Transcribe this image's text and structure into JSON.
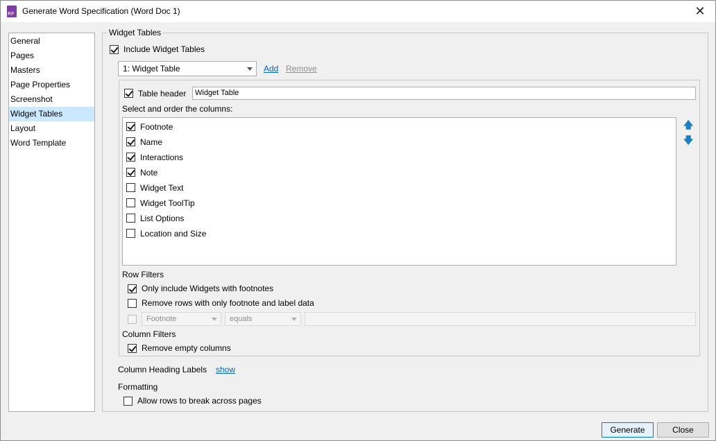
{
  "window": {
    "title": "Generate Word Specification (Word Doc 1)",
    "app_icon_text": "RP",
    "close_symbol": "✕"
  },
  "sidebar": {
    "items": [
      {
        "label": "General"
      },
      {
        "label": "Pages"
      },
      {
        "label": "Masters"
      },
      {
        "label": "Page Properties"
      },
      {
        "label": "Screenshot"
      },
      {
        "label": "Widget Tables",
        "selected": true
      },
      {
        "label": "Layout"
      },
      {
        "label": "Word Template"
      }
    ]
  },
  "widget_tables": {
    "group_title": "Widget Tables",
    "include_label": "Include Widget Tables",
    "include_checked": true,
    "table_select_value": "1: Widget Table",
    "add_label": "Add",
    "remove_label": "Remove",
    "table_header_label": "Table header",
    "table_header_checked": true,
    "table_header_value": "Widget Table",
    "columns_label": "Select and order the columns:",
    "columns": [
      {
        "label": "Footnote",
        "checked": true
      },
      {
        "label": "Name",
        "checked": true
      },
      {
        "label": "Interactions",
        "checked": true
      },
      {
        "label": "Note",
        "checked": true
      },
      {
        "label": "Widget Text",
        "checked": false
      },
      {
        "label": "Widget ToolTip",
        "checked": false
      },
      {
        "label": "List Options",
        "checked": false
      },
      {
        "label": "Location and Size",
        "checked": false
      }
    ],
    "move_up_symbol": "🡅",
    "move_down_symbol": "🡇",
    "row_filters_label": "Row Filters",
    "only_footnotes_label": "Only include Widgets with footnotes",
    "only_footnotes_checked": true,
    "remove_rows_label": "Remove rows with only footnote and label data",
    "remove_rows_checked": false,
    "custom_filter_field": "Footnote",
    "custom_filter_operator": "equals",
    "custom_filter_value": "",
    "column_filters_label": "Column Filters",
    "remove_empty_columns_label": "Remove empty columns",
    "remove_empty_columns_checked": true,
    "column_heading_labels_label": "Column Heading Labels",
    "show_link_label": "show",
    "formatting_label": "Formatting",
    "allow_break_label": "Allow rows to break across pages",
    "allow_break_checked": false
  },
  "footer": {
    "generate_label": "Generate",
    "close_label": "Close"
  }
}
